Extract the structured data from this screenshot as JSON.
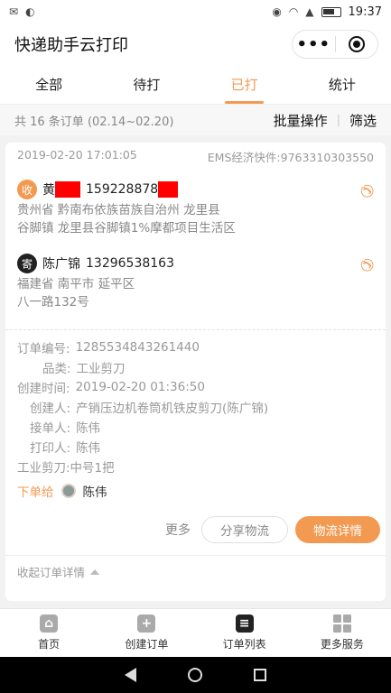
{
  "status_bar": {
    "time": "19:37"
  },
  "app": {
    "title": "快递助手云打印",
    "menu_dots": "•••"
  },
  "tabs": [
    "全部",
    "待打",
    "已打",
    "统计"
  ],
  "active_tab": "已打",
  "summary": {
    "count_text": "共 16 条订单 (02.14~02.20)",
    "batch_label": "批量操作",
    "separator": "|",
    "filter_label": "筛选"
  },
  "order": {
    "datetime": "2019-02-20 17:01:05",
    "express": "EMS经济快件:9763310303550",
    "receiver": {
      "badge": "收",
      "name": "黄",
      "phone": "159228878",
      "address_line1": "贵州省 黔南布依族苗族自治州 龙里县",
      "address_line2": "谷脚镇 龙里县谷脚镇1%摩都项目生活区"
    },
    "sender": {
      "badge": "寄",
      "name": "陈广锦",
      "phone": "13296538163",
      "address_line1": "福建省 南平市 延平区",
      "address_line2": "八一路132号"
    },
    "details": [
      {
        "label": "订单编号:",
        "value": "1285534843261440"
      },
      {
        "label": "品类:",
        "value": "工业剪刀"
      },
      {
        "label": "创建时间:",
        "value": "2019-02-20 01:36:50"
      },
      {
        "label": "创建人:",
        "value": "产销压边机卷筒机铁皮剪刀(陈广锦)"
      },
      {
        "label": "接单人:",
        "value": "陈伟"
      },
      {
        "label": "打印人:",
        "value": "陈伟"
      }
    ],
    "item_line": "工业剪刀:中号1把",
    "assign_label": "下单给",
    "assign_name": "陈伟",
    "more_label": "更多",
    "share_label": "分享物流",
    "logistics_label": "物流详情",
    "collapse_label": "收起订单详情"
  },
  "bottom_nav": [
    {
      "label": "首页",
      "icon": "home-icon"
    },
    {
      "label": "创建订单",
      "icon": "plus-icon"
    },
    {
      "label": "订单列表",
      "icon": "list-icon"
    },
    {
      "label": "更多服务",
      "icon": "grid-icon"
    }
  ],
  "colors": {
    "accent": "#f39a52",
    "redaction": "#ff0000"
  }
}
